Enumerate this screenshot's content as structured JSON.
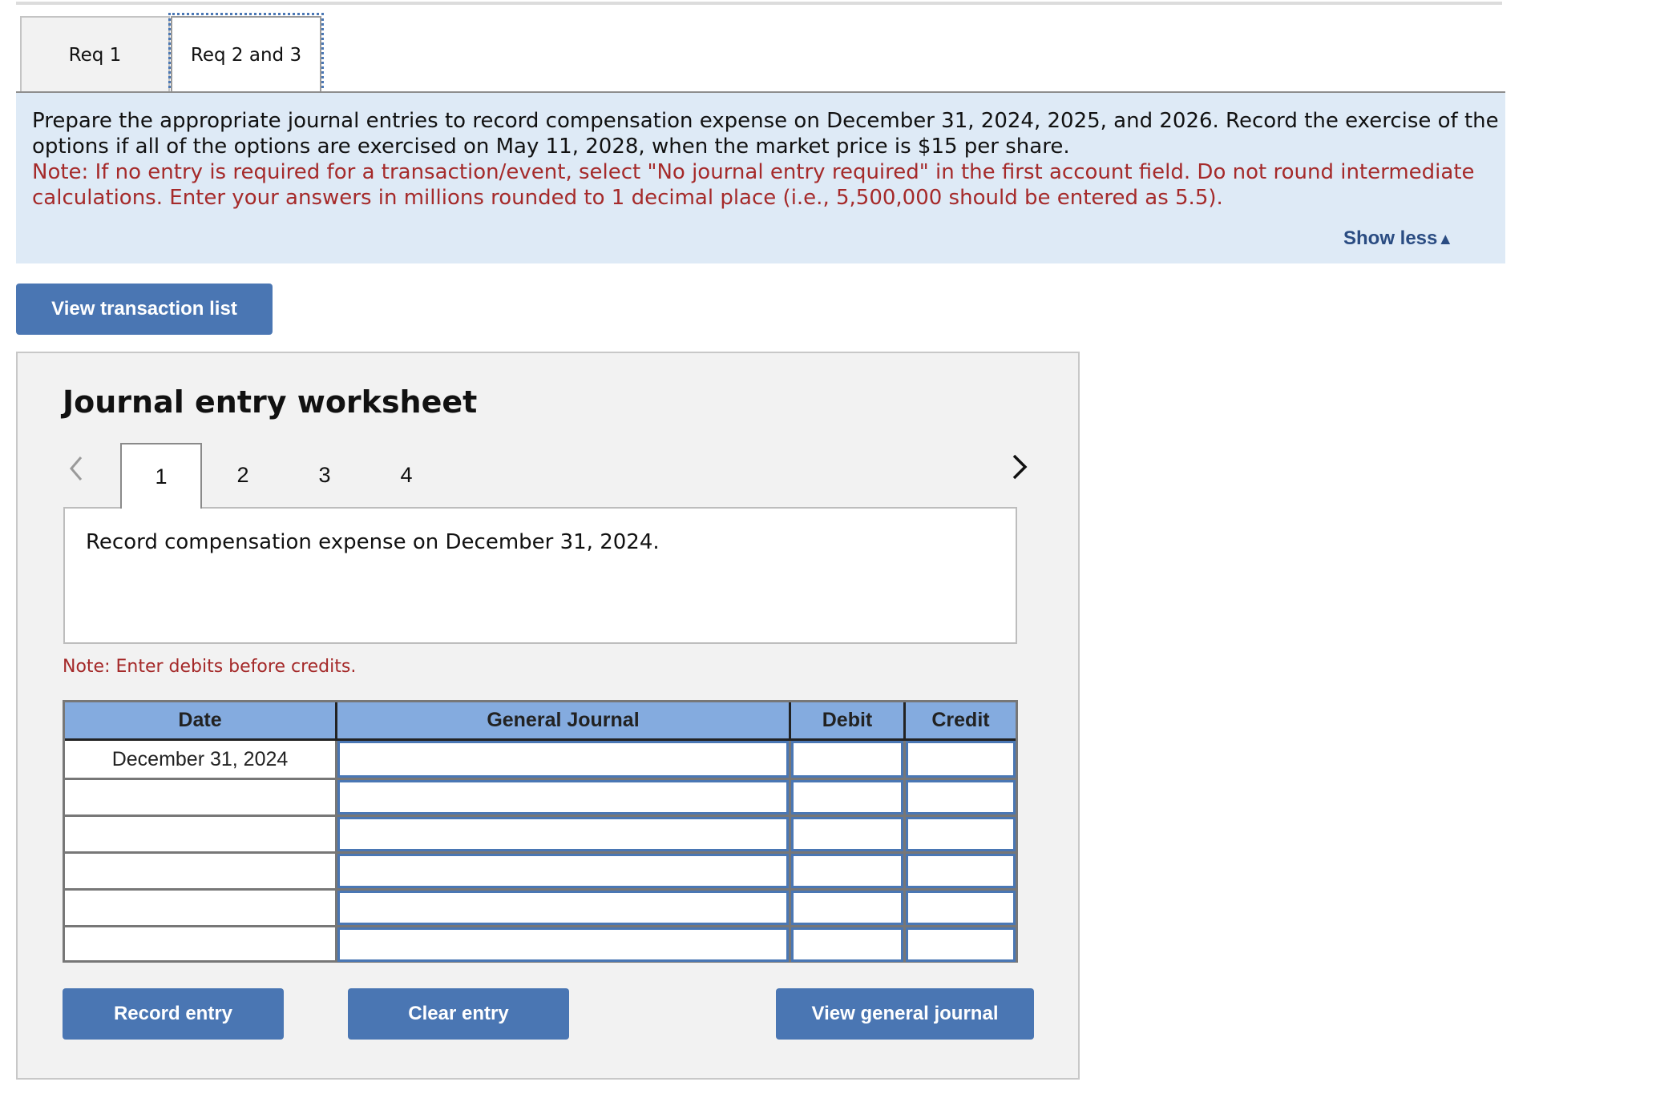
{
  "req_tabs": [
    {
      "label": "Req 1",
      "active": false
    },
    {
      "label": "Req 2 and 3",
      "active": true
    }
  ],
  "instructions": {
    "text": "Prepare the appropriate journal entries to record compensation expense on December 31, 2024, 2025, and 2026. Record the exercise of the options if all of the options are exercised on May 11, 2028, when the market price is $15 per share.",
    "note": "Note: If no entry is required for a transaction/event, select \"No journal entry required\" in the first account field. Do not round intermediate calculations. Enter your answers in millions rounded to 1 decimal place (i.e., 5,500,000 should be entered as 5.5).",
    "show_less_label": "Show less",
    "show_less_icon": "triangle-up-icon"
  },
  "view_transaction_list_label": "View transaction list",
  "worksheet": {
    "title": "Journal entry worksheet",
    "prev_icon": "chevron-left-icon",
    "next_icon": "chevron-right-icon",
    "entry_tabs": [
      {
        "label": "1",
        "active": true
      },
      {
        "label": "2",
        "active": false
      },
      {
        "label": "3",
        "active": false
      },
      {
        "label": "4",
        "active": false
      }
    ],
    "description": "Record compensation expense on December 31, 2024.",
    "note": "Note: Enter debits before credits.",
    "table": {
      "headers": {
        "date": "Date",
        "general_journal": "General Journal",
        "debit": "Debit",
        "credit": "Credit"
      },
      "rows": [
        {
          "date": "December 31, 2024",
          "account": "",
          "debit": "",
          "credit": ""
        },
        {
          "date": "",
          "account": "",
          "debit": "",
          "credit": ""
        },
        {
          "date": "",
          "account": "",
          "debit": "",
          "credit": ""
        },
        {
          "date": "",
          "account": "",
          "debit": "",
          "credit": ""
        },
        {
          "date": "",
          "account": "",
          "debit": "",
          "credit": ""
        },
        {
          "date": "",
          "account": "",
          "debit": "",
          "credit": ""
        }
      ]
    },
    "buttons": {
      "record": "Record entry",
      "clear": "Clear entry",
      "view_general_journal": "View general journal"
    }
  },
  "colors": {
    "button_blue": "#4a76b3",
    "header_blue": "#84abdf",
    "info_bg": "#deeaf6",
    "note_red": "#a52a2a",
    "link_blue": "#2a4c82"
  }
}
